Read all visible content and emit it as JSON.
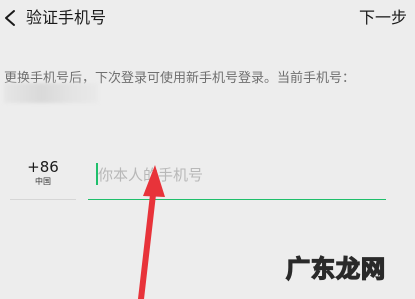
{
  "header": {
    "back_icon": "chevron-left-icon",
    "title": "验证手机号",
    "next_label": "下一步"
  },
  "notice": {
    "text": "更换手机号后，下次登录可使用新手机号登录。当前手机号："
  },
  "country": {
    "code": "+86",
    "name": "中国"
  },
  "phone_input": {
    "value": "",
    "placeholder": "你本人的手机号"
  },
  "watermark": {
    "text": "广东龙网"
  },
  "colors": {
    "accent": "#1fbf6b",
    "arrow": "#e8333a",
    "background": "#ededed"
  }
}
